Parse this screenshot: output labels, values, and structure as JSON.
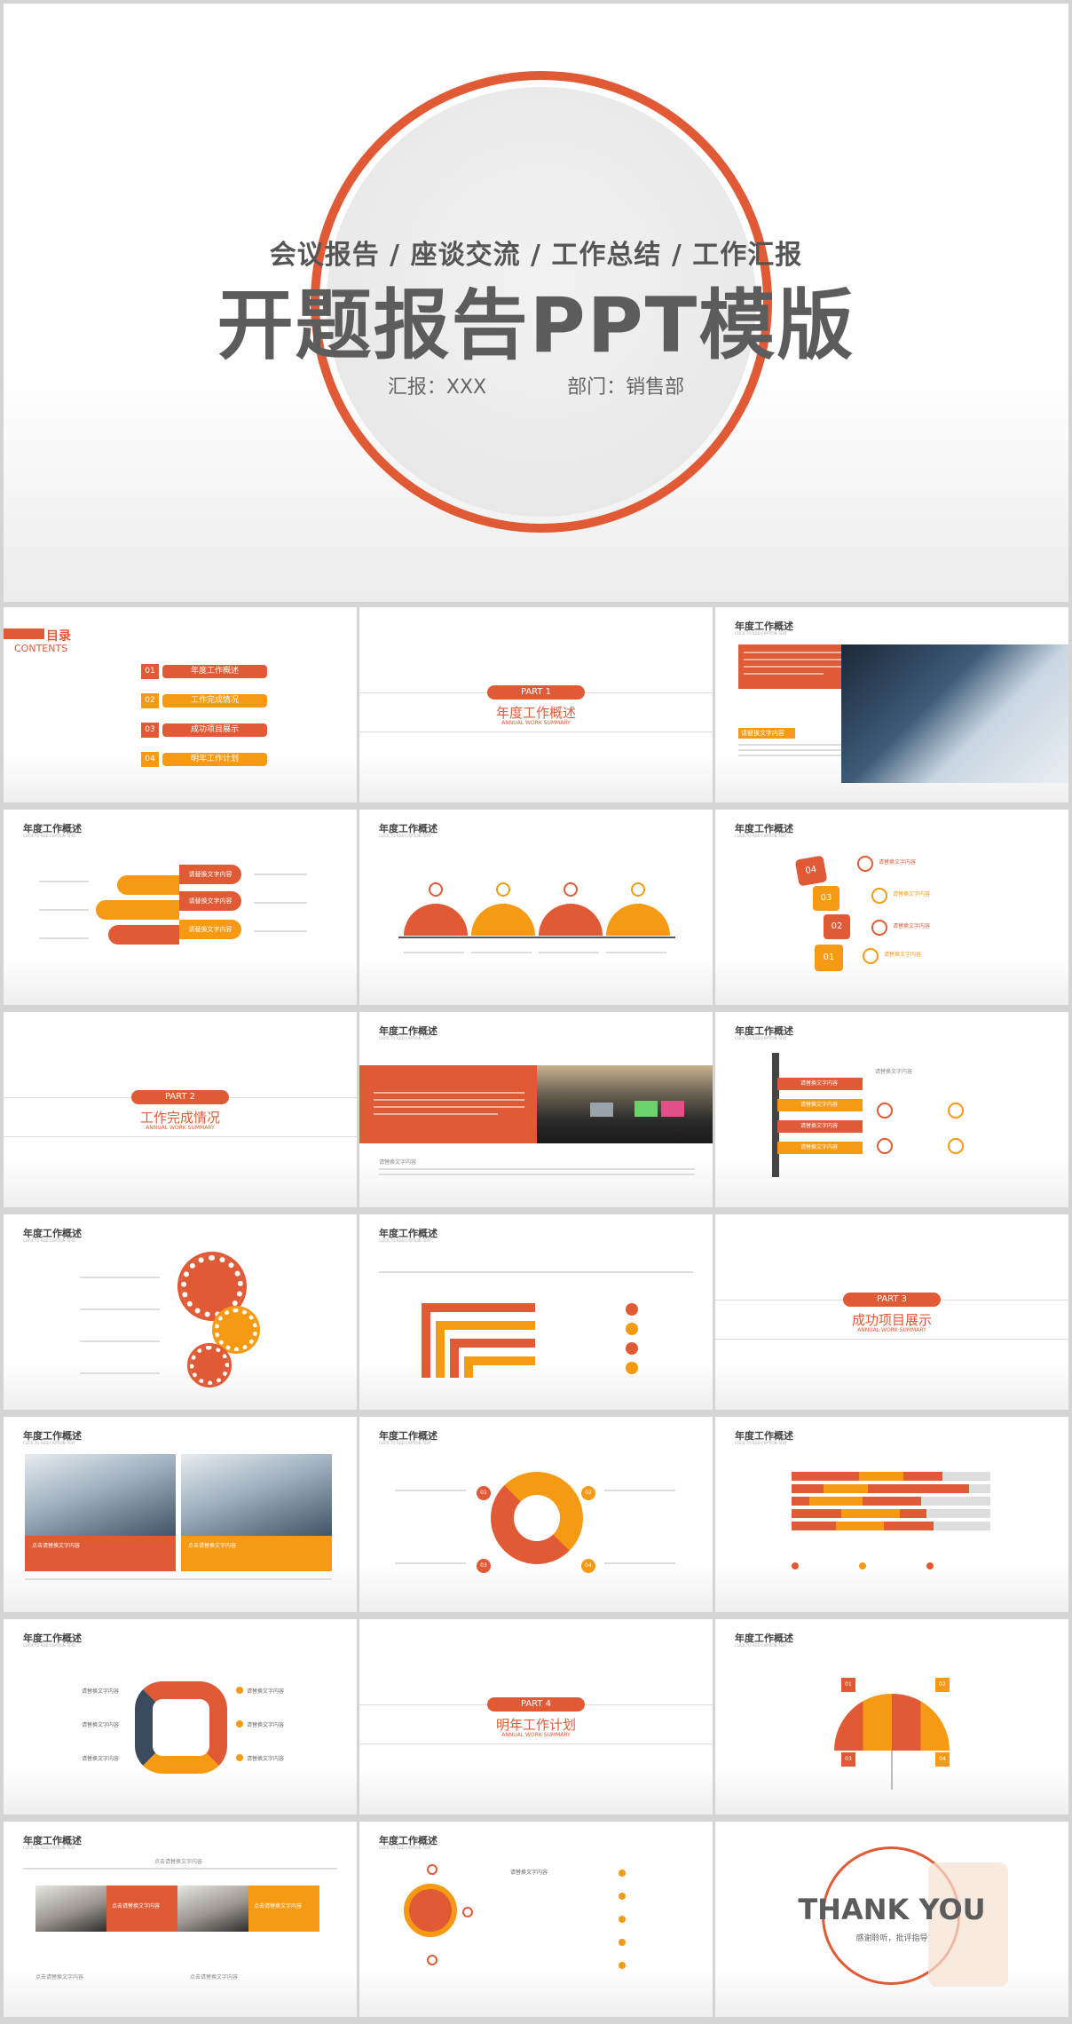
{
  "colors": {
    "primary": "#e05a35",
    "accent": "#f59a12",
    "text": "#5c5c5c"
  },
  "cover": {
    "subtitle": "会议报告 / 座谈交流 / 工作总结 / 工作汇报",
    "title": "开题报告PPT模版",
    "reporter": "汇报：XXX",
    "department": "部门：销售部"
  },
  "toc": {
    "heading": "目录",
    "heading_en": "CONTENTS",
    "items": [
      {
        "num": "01",
        "label": "年度工作概述"
      },
      {
        "num": "02",
        "label": "工作完成情况"
      },
      {
        "num": "03",
        "label": "成功项目展示"
      },
      {
        "num": "04",
        "label": "明年工作计划"
      }
    ]
  },
  "slide_header": "年度工作概述",
  "parts": [
    {
      "pill": "PART 1",
      "title": "年度工作概述",
      "en": "ANNUAL WORK SUMMARY"
    },
    {
      "pill": "PART 2",
      "title": "工作完成情况",
      "en": "ANNUAL WORK SUMMARY"
    },
    {
      "pill": "PART 3",
      "title": "成功项目展示",
      "en": "ANNUAL WORK SUMMARY"
    },
    {
      "pill": "PART 4",
      "title": "明年工作计划",
      "en": "ANNUAL WORK SUMMARY"
    }
  ],
  "placeholder": "请替换文字内容",
  "placeholder_click": "点击请替换文字内容",
  "steps": [
    "04",
    "03",
    "02",
    "01"
  ],
  "thanks": {
    "title": "THANK YOU",
    "subtitle": "感谢聆听，批评指导"
  }
}
